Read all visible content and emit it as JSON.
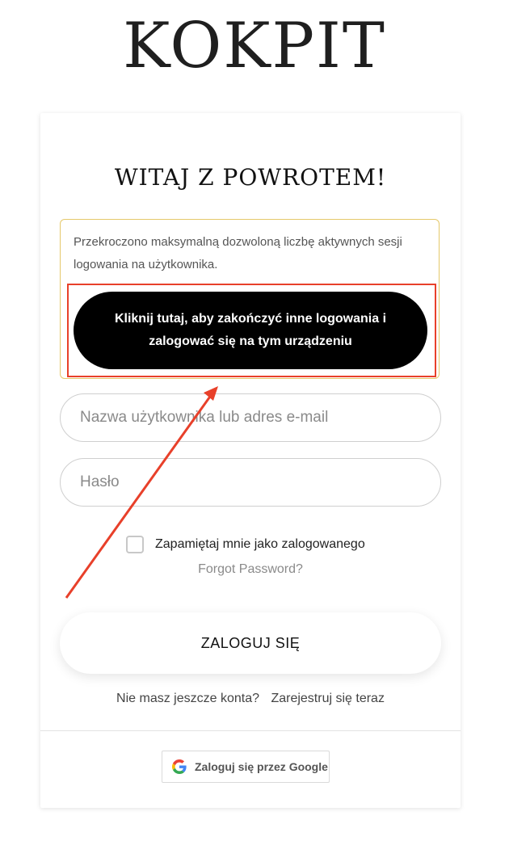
{
  "site": {
    "title": "KOKPIT"
  },
  "card": {
    "heading": "WITAJ Z POWROTEM!"
  },
  "notice": {
    "text": "Przekroczono maksymalną dozwoloną liczbę aktywnych sesji logowania na użytkownika.",
    "button_label": "Kliknij tutaj, aby zakończyć inne logowania i zalogować się na tym urządzeniu"
  },
  "form": {
    "username_placeholder": "Nazwa użytkownika lub adres e-mail",
    "password_placeholder": "Hasło",
    "remember_label": "Zapamiętaj mnie jako zalogowanego",
    "remember_checked": false,
    "forgot_label": "Forgot Password?",
    "login_label": "ZALOGUJ SIĘ"
  },
  "register": {
    "prompt": "Nie masz jeszcze konta?",
    "link_label": "Zarejestruj się teraz"
  },
  "google": {
    "label": "Zaloguj się przez Google"
  },
  "colors": {
    "annotation_red": "#e8402a",
    "notice_border": "#e5c86a",
    "primary_button": "#000000"
  }
}
